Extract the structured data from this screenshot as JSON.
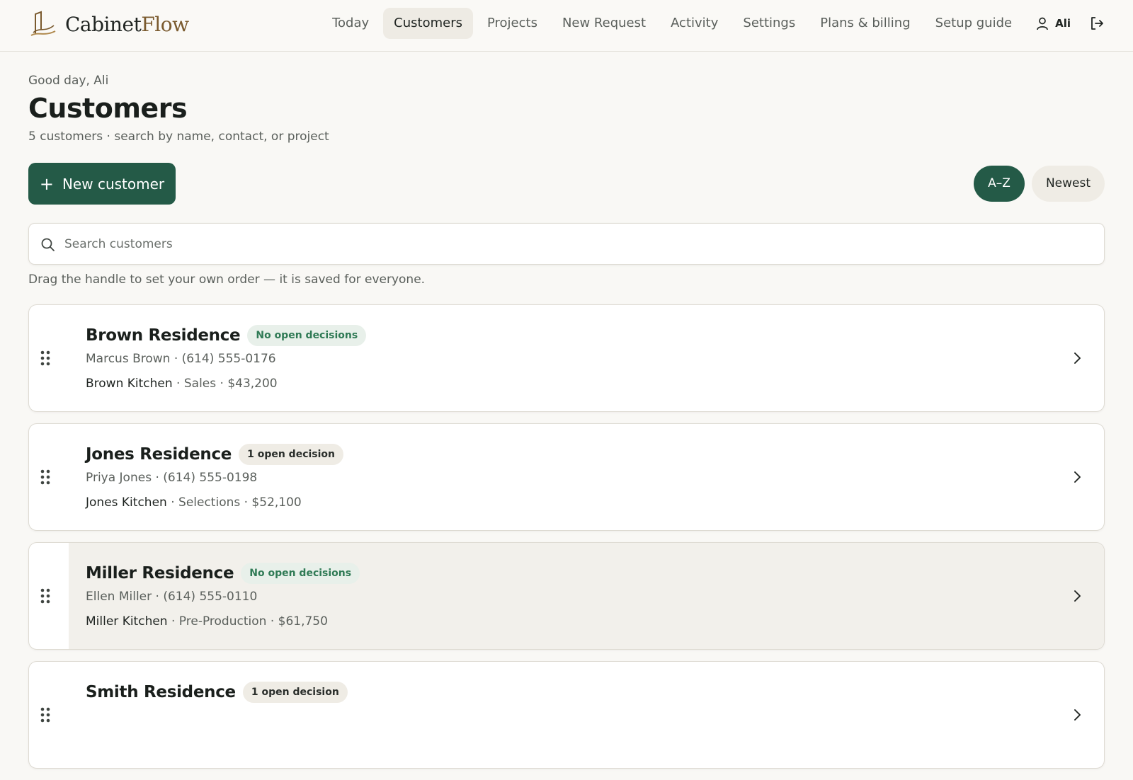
{
  "brand": {
    "name_part1": "Cabinet",
    "name_part2": "Flow"
  },
  "nav": {
    "items": [
      {
        "label": "Today",
        "active": false
      },
      {
        "label": "Customers",
        "active": true
      },
      {
        "label": "Projects",
        "active": false
      },
      {
        "label": "New Request",
        "active": false
      },
      {
        "label": "Activity",
        "active": false
      },
      {
        "label": "Settings",
        "active": false
      },
      {
        "label": "Plans & billing",
        "active": false
      },
      {
        "label": "Setup guide",
        "active": false
      }
    ],
    "user_name": "Ali",
    "user_icon": "user-icon",
    "logout_icon": "logout-icon"
  },
  "header": {
    "greeting": "Good day, Ali",
    "title": "Customers",
    "subtitle": "5 customers · search by name, contact, or project"
  },
  "actions": {
    "new_customer_label": "New customer",
    "sort_options": [
      {
        "label": "A–Z",
        "active": true
      },
      {
        "label": "Newest",
        "active": false
      }
    ]
  },
  "search": {
    "placeholder": "Search customers",
    "value": ""
  },
  "hint": "Drag the handle to set your own order — it is saved for everyone.",
  "customers": [
    {
      "name": "Brown Residence",
      "badge": "No open decisions",
      "badge_style": "green",
      "contact": "Marcus Brown · (614) 555-0176",
      "project_name": "Brown Kitchen",
      "project_meta": " · Sales · $43,200"
    },
    {
      "name": "Jones Residence",
      "badge": "1 open decision",
      "badge_style": "neutral",
      "contact": "Priya Jones · (614) 555-0198",
      "project_name": "Jones Kitchen",
      "project_meta": " · Selections · $52,100"
    },
    {
      "name": "Miller Residence",
      "badge": "No open decisions",
      "badge_style": "green",
      "contact": "Ellen Miller · (614) 555-0110",
      "project_name": "Miller Kitchen",
      "project_meta": " · Pre-Production · $61,750"
    },
    {
      "name": "Smith Residence",
      "badge": "1 open decision",
      "badge_style": "neutral",
      "contact": "",
      "project_name": "",
      "project_meta": ""
    }
  ],
  "colors": {
    "accent": "#245a47",
    "background": "#f9f8f5",
    "badge_green_text": "#2f7a55",
    "badge_green_bg": "#e8f0ea"
  }
}
